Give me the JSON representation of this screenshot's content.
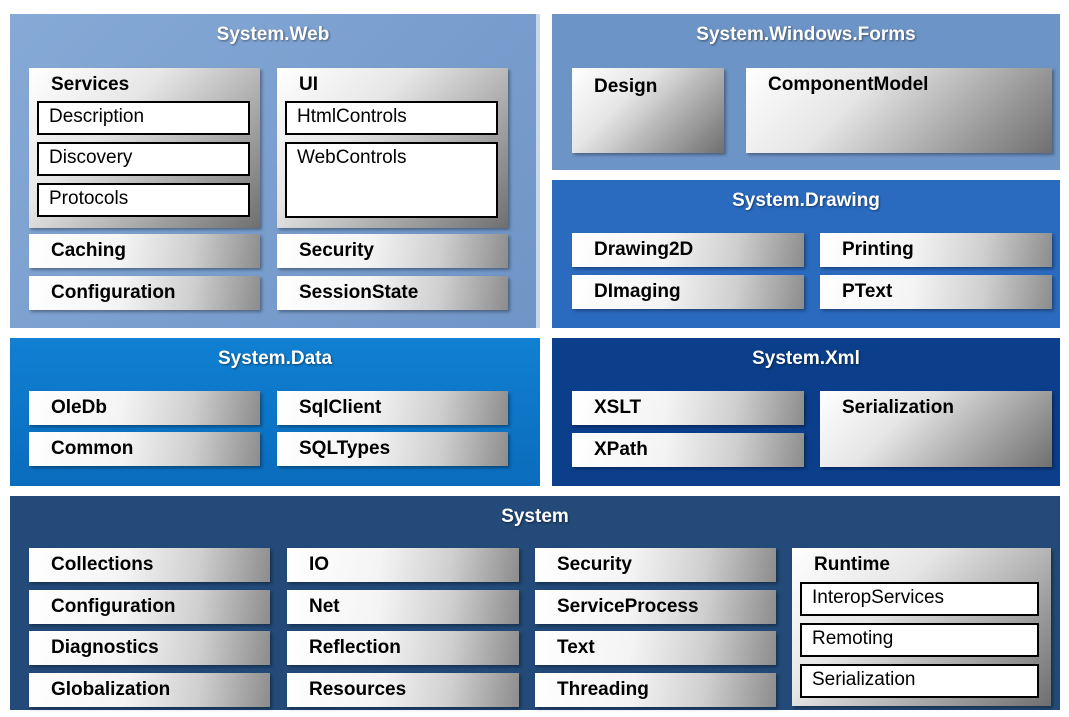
{
  "system_web": {
    "title": "System.Web",
    "services": {
      "title": "Services",
      "items": [
        "Description",
        "Discovery",
        "Protocols"
      ]
    },
    "ui": {
      "title": "UI",
      "items": [
        "HtmlControls",
        "WebControls"
      ]
    },
    "boxes": [
      "Caching",
      "Security",
      "Configuration",
      "SessionState"
    ]
  },
  "system_windows_forms": {
    "title": "System.Windows.Forms",
    "boxes": [
      "Design",
      "ComponentModel"
    ]
  },
  "system_drawing": {
    "title": "System.Drawing",
    "boxes": [
      "Drawing2D",
      "Printing",
      "DImaging",
      "PText"
    ]
  },
  "system_data": {
    "title": "System.Data",
    "boxes": [
      "OleDb",
      "SqlClient",
      "Common",
      "SQLTypes"
    ]
  },
  "system_xml": {
    "title": "System.Xml",
    "boxes": [
      "XSLT",
      "Serialization",
      "XPath"
    ]
  },
  "system": {
    "title": "System",
    "col1": [
      "Collections",
      "Configuration",
      "Diagnostics",
      "Globalization"
    ],
    "col2": [
      "IO",
      "Net",
      "Reflection",
      "Resources"
    ],
    "col3": [
      "Security",
      "ServiceProcess",
      "Text",
      "Threading"
    ],
    "runtime": {
      "title": "Runtime",
      "items": [
        "InteropServices",
        "Remoting",
        "Serialization"
      ]
    }
  }
}
